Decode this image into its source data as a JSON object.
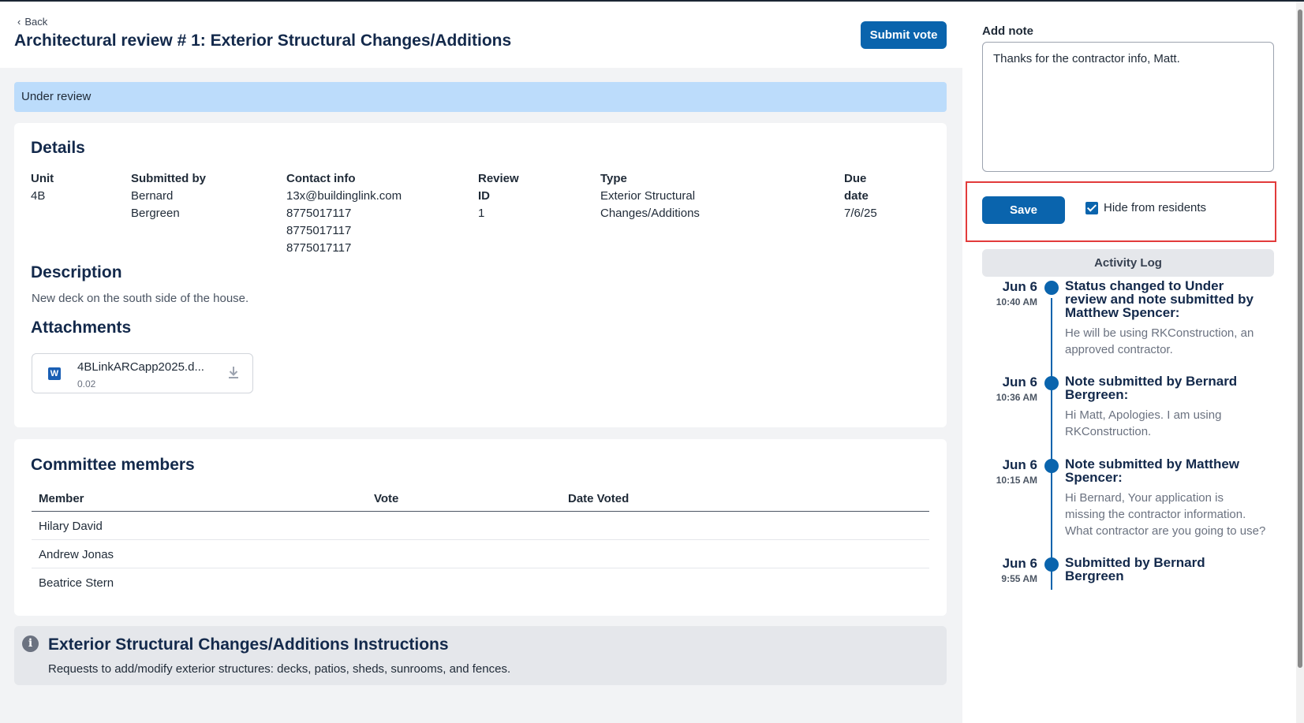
{
  "header": {
    "back_label": "Back",
    "title": "Architectural review # 1: Exterior Structural Changes/Additions",
    "submit_vote_label": "Submit vote"
  },
  "status": "Under review",
  "details": {
    "title": "Details",
    "unit": {
      "label": "Unit",
      "lines": [
        "4B"
      ]
    },
    "submitted_by": {
      "label": "Submitted by",
      "lines": [
        "Bernard",
        "Bergreen"
      ]
    },
    "contact_info": {
      "label": "Contact info",
      "lines": [
        "13x@buildinglink.com",
        "8775017117",
        "8775017117",
        "8775017117"
      ]
    },
    "review_id": {
      "label_lines": [
        "Review",
        "ID"
      ],
      "value": "1"
    },
    "type": {
      "label": "Type",
      "lines": [
        "Exterior Structural",
        "Changes/Additions"
      ]
    },
    "due_date": {
      "label_lines": [
        "Due",
        "date"
      ],
      "value": "7/6/25"
    }
  },
  "description": {
    "title": "Description",
    "text": "New deck on the south side of the house."
  },
  "attachments": {
    "title": "Attachments",
    "items": [
      {
        "icon": "word-doc-icon",
        "icon_letter": "W",
        "name": "4BLinkARCapp2025.d...",
        "size": "0.02"
      }
    ]
  },
  "committee": {
    "title": "Committee members",
    "columns": [
      "Member",
      "Vote",
      "Date Voted"
    ],
    "rows": [
      {
        "member": "Hilary David",
        "vote": "",
        "date": ""
      },
      {
        "member": "Andrew Jonas",
        "vote": "",
        "date": ""
      },
      {
        "member": "Beatrice Stern",
        "vote": "",
        "date": ""
      }
    ]
  },
  "instructions": {
    "icon": "info-icon",
    "icon_glyph": "i",
    "title": "Exterior Structural Changes/Additions Instructions",
    "text": "Requests to add/modify exterior structures: decks, patios, sheds, sunrooms, and fences."
  },
  "note_panel": {
    "label": "Add note",
    "note_value": "Thanks for the contractor info, Matt.",
    "save_label": "Save",
    "hide_label": "Hide from residents",
    "hide_checked": true,
    "activity_log_label": "Activity Log"
  },
  "activity": [
    {
      "date": "Jun 6",
      "time": "10:40 AM",
      "title": "Status changed to Under review and note submitted by Matthew Spencer:",
      "body": "He will be using RKConstruction, an approved contractor."
    },
    {
      "date": "Jun 6",
      "time": "10:36 AM",
      "title": "Note submitted by Bernard Bergreen:",
      "body": "Hi Matt, Apologies. I am using RKConstruction."
    },
    {
      "date": "Jun 6",
      "time": "10:15 AM",
      "title": "Note submitted by Matthew Spencer:",
      "body": "Hi Bernard, Your application is missing the contractor information. What contractor are you going to use?"
    },
    {
      "date": "Jun 6",
      "time": "9:55 AM",
      "title": "Submitted by Bernard Bergreen",
      "body": ""
    }
  ],
  "colors": {
    "primary": "#0a64ad",
    "status_bg": "#bcdcfb",
    "highlight": "#e23b3b",
    "heading": "#13294b"
  }
}
